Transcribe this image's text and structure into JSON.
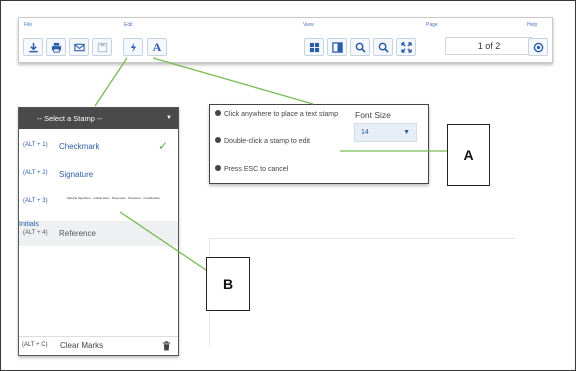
{
  "toolbar": {
    "groups": {
      "file": "File",
      "edit": "Edit",
      "view": "View",
      "page": "Page",
      "help": "Help"
    },
    "page_indicator": "1 of 2",
    "buttons": [
      {
        "name": "download-icon",
        "group": "file"
      },
      {
        "name": "print-icon",
        "group": "file"
      },
      {
        "name": "email-icon",
        "group": "file"
      },
      {
        "name": "save-icon",
        "group": "file",
        "disabled": true
      },
      {
        "name": "stamp-icon",
        "group": "edit"
      },
      {
        "name": "text-icon",
        "group": "edit"
      },
      {
        "name": "thumbnails-icon",
        "group": "view"
      },
      {
        "name": "sidebar-icon",
        "group": "view"
      },
      {
        "name": "zoom-in-icon",
        "group": "view"
      },
      {
        "name": "zoom-out-icon",
        "group": "view"
      },
      {
        "name": "fit-screen-icon",
        "group": "view"
      },
      {
        "name": "help-icon",
        "group": "help"
      }
    ]
  },
  "stamp_panel": {
    "header": "-- Select a Stamp --",
    "items": [
      {
        "key": "(ALT + 1)",
        "label": "Checkmark",
        "selected": true
      },
      {
        "key": "(ALT + 2)",
        "label": "Signature"
      },
      {
        "key": "(ALT + 3)",
        "label": "",
        "preview": "Sample Signature · Initials Here · Date Here · Reviewer · Confidential"
      },
      {
        "key": "(ALT + 4)",
        "label": "Reference",
        "group_label": "Initials"
      }
    ],
    "footer": {
      "key": "(ALT + C)",
      "label": "Clear Marks"
    }
  },
  "instructions": {
    "items": [
      "Click anywhere to place a text stamp",
      "Double-click a stamp to edit",
      "Press ESC to cancel"
    ],
    "font_size_label": "Font Size",
    "font_size_value": "14"
  },
  "callouts": {
    "a": "A",
    "b": "B"
  },
  "colors": {
    "accent": "#2b5ea9",
    "check": "#5ab050",
    "callout_line": "#77bb55",
    "panel_header": "#4a4a4a"
  }
}
